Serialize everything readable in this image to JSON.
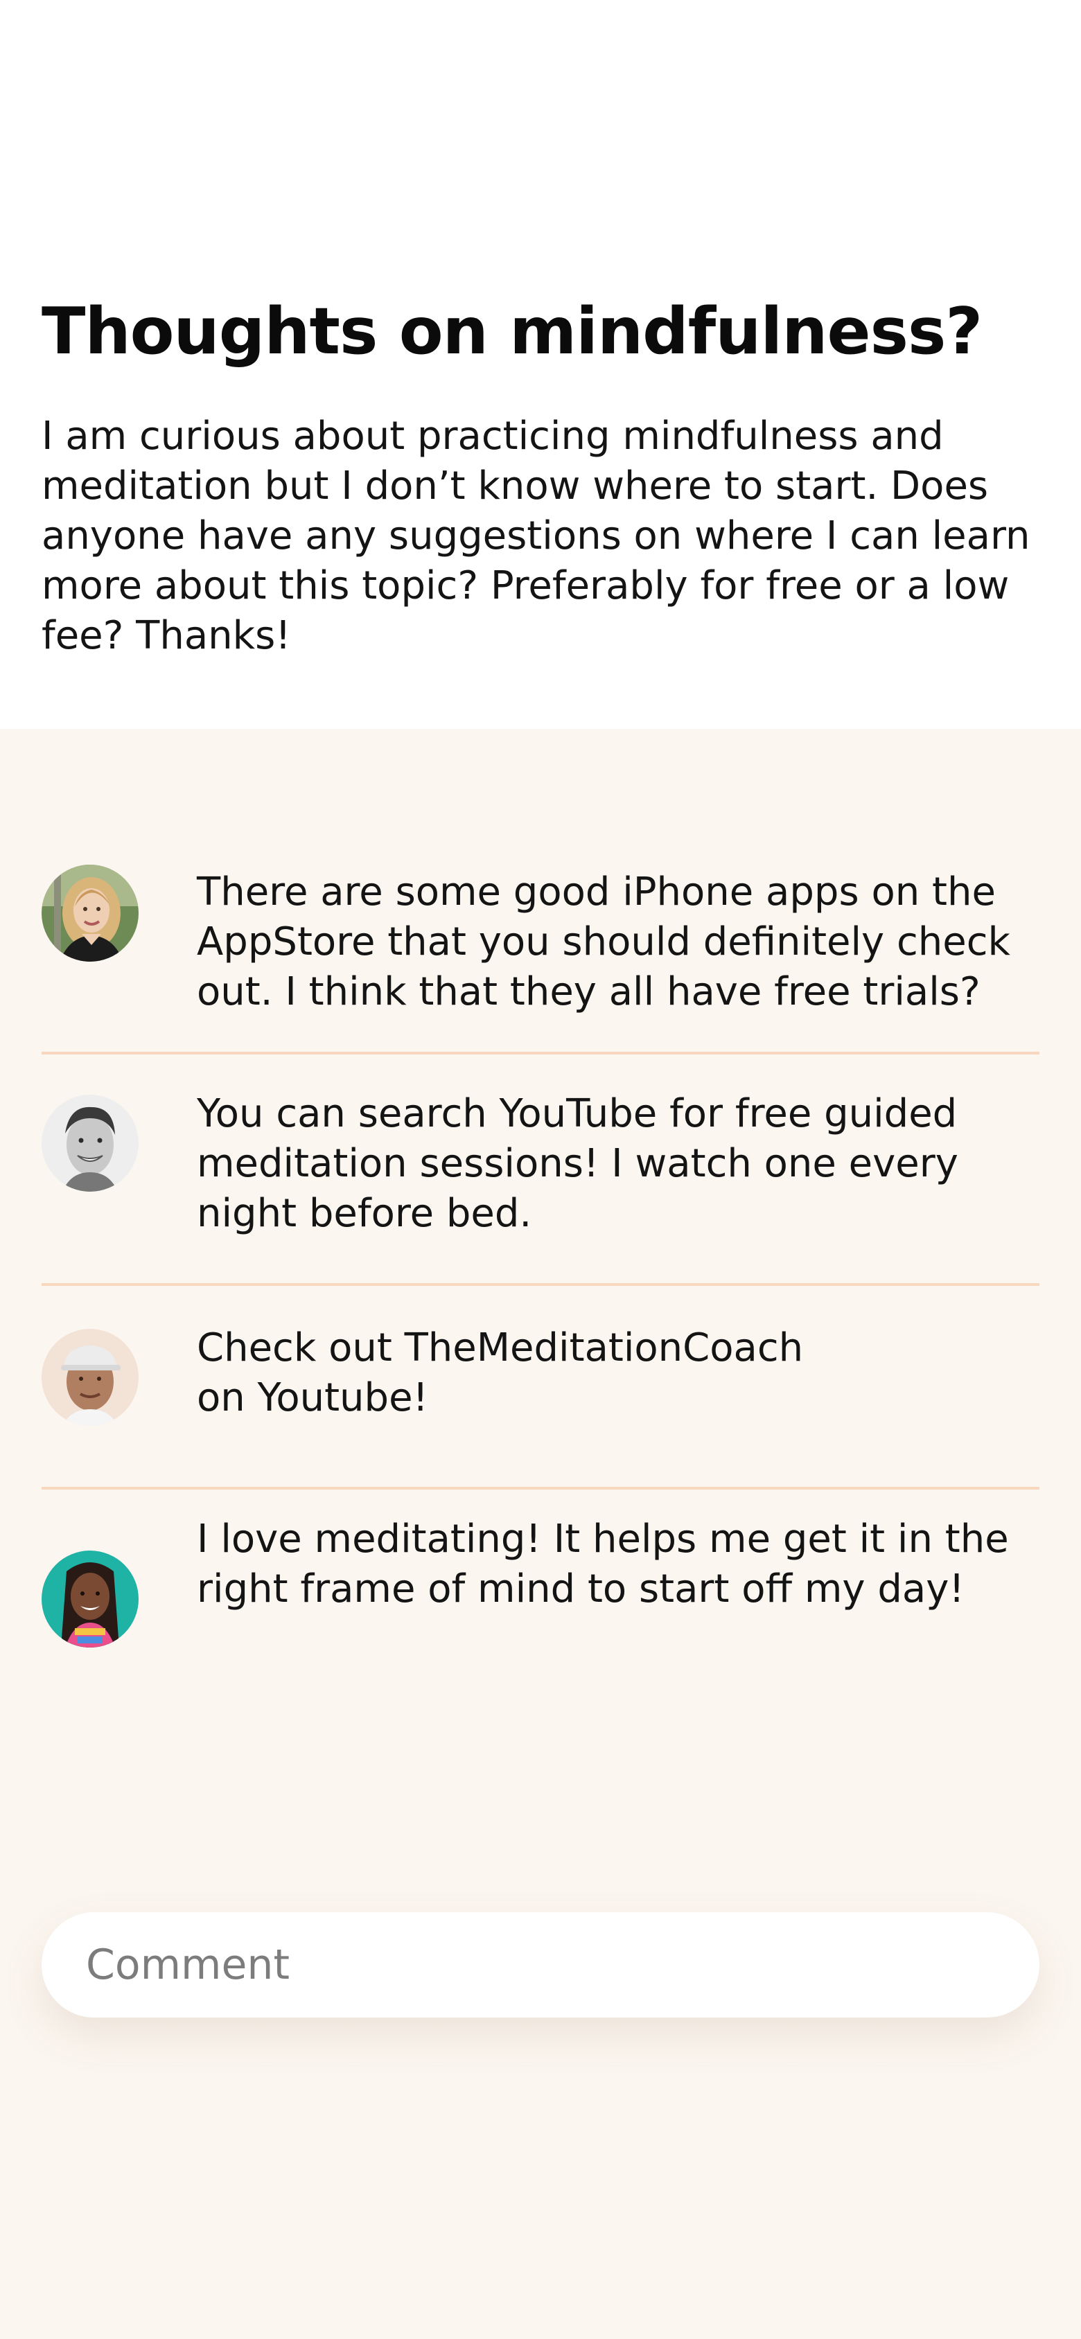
{
  "post": {
    "title": "Thoughts on mindfulness?",
    "body": "I am curious about practicing mindfulness and meditation but I don’t know where to start. Does anyone have any suggestions on where I can learn more about this topic? Preferably for free or a low fee? Thanks!"
  },
  "comments": [
    {
      "avatar_icon": "woman-blonde-avatar",
      "text": "There are some good iPhone apps on the AppStore that you should definitely check out. I think that they all have free trials?"
    },
    {
      "avatar_icon": "man-smiling-avatar",
      "text": "You can search YouTube for free guided meditation sessions! I watch one every night before bed."
    },
    {
      "avatar_icon": "man-cap-avatar",
      "text": "Check out TheMeditationCoach\non Youtube!"
    },
    {
      "avatar_icon": "woman-braids-avatar",
      "text": "I love meditating! It helps me get it in the right frame of mind to start off my day!"
    }
  ],
  "comment_field": {
    "placeholder": "Comment",
    "value": ""
  },
  "colors": {
    "page_background": "#fbf6f0",
    "post_background": "#ffffff",
    "divider": "#f8d7bf",
    "placeholder": "#7c7c7c"
  }
}
